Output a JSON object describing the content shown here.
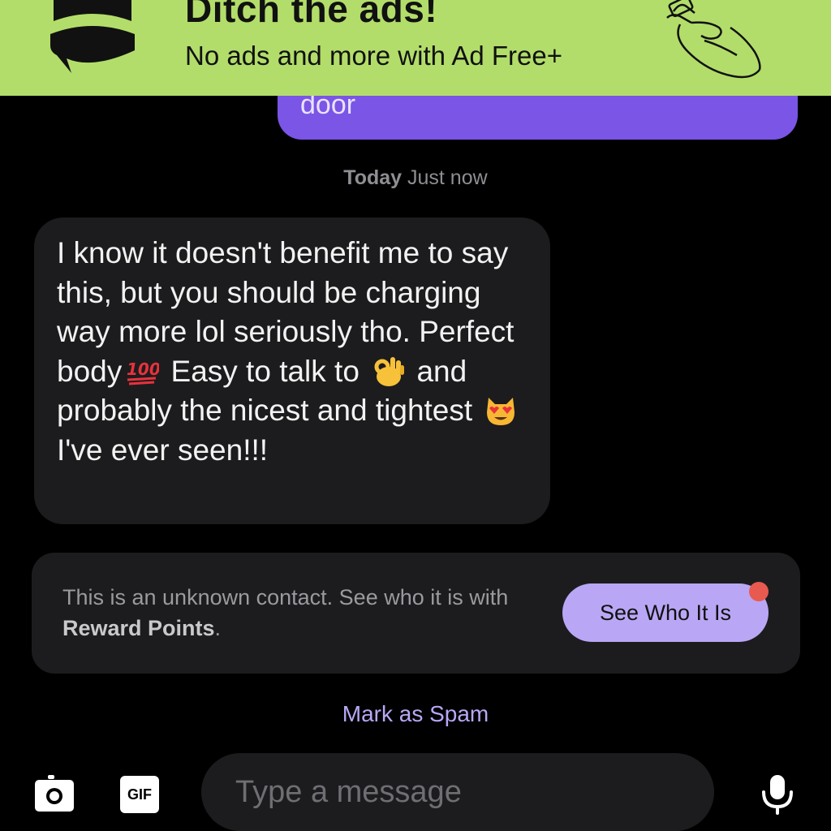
{
  "ad": {
    "title": "Ditch the ads!",
    "subtitle": "No ads and more with Ad Free+",
    "logo_icon": "speech-bubble-logo-icon",
    "art_icon": "hand-holding-ad-icon",
    "background_color": "#b2dd6a"
  },
  "conversation": {
    "sent_message_fragment": "door",
    "sent_bubble_color": "#7b55e6",
    "timestamp": {
      "day": "Today",
      "time": "Just now"
    },
    "received_message": {
      "part1": "I know it doesn't benefit me to say this, but you should be charging way more lol seriously tho. Perfect body",
      "emoji1": "hundred-points-emoji",
      "part2": "Easy to talk to",
      "emoji2": "ok-hand-emoji",
      "part3": "and probably the nicest and tightest",
      "emoji3": "heart-eyes-cat-emoji",
      "part4": "I've ever seen!!!"
    }
  },
  "unknown_contact": {
    "text_prefix": "This is an unknown contact. See who it is with ",
    "text_bold": "Reward Points",
    "text_suffix": ".",
    "button_label": "See Who It Is",
    "button_color": "#b9a7f5",
    "notification_dot_color": "#e85a4f"
  },
  "mark_spam_label": "Mark as Spam",
  "composer": {
    "camera_icon": "camera-icon",
    "gif_label": "GIF",
    "placeholder": "Type a message",
    "value": "",
    "mic_icon": "microphone-icon"
  }
}
